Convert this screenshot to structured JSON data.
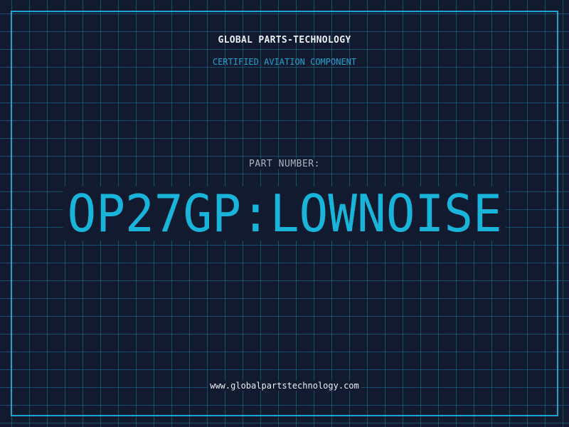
{
  "header": {
    "brand": "GLOBAL PARTS-TECHNOLOGY",
    "tagline": "CERTIFIED AVIATION COMPONENT"
  },
  "part": {
    "label": "PART NUMBER:",
    "number": "OP27GP:LOWNOISE"
  },
  "footer": {
    "url": "www.globalpartstechnology.com"
  },
  "colors": {
    "background": "#111a2e",
    "accent": "#1fa3cf",
    "grid": "#1b7696",
    "text": "#e9eef5"
  }
}
